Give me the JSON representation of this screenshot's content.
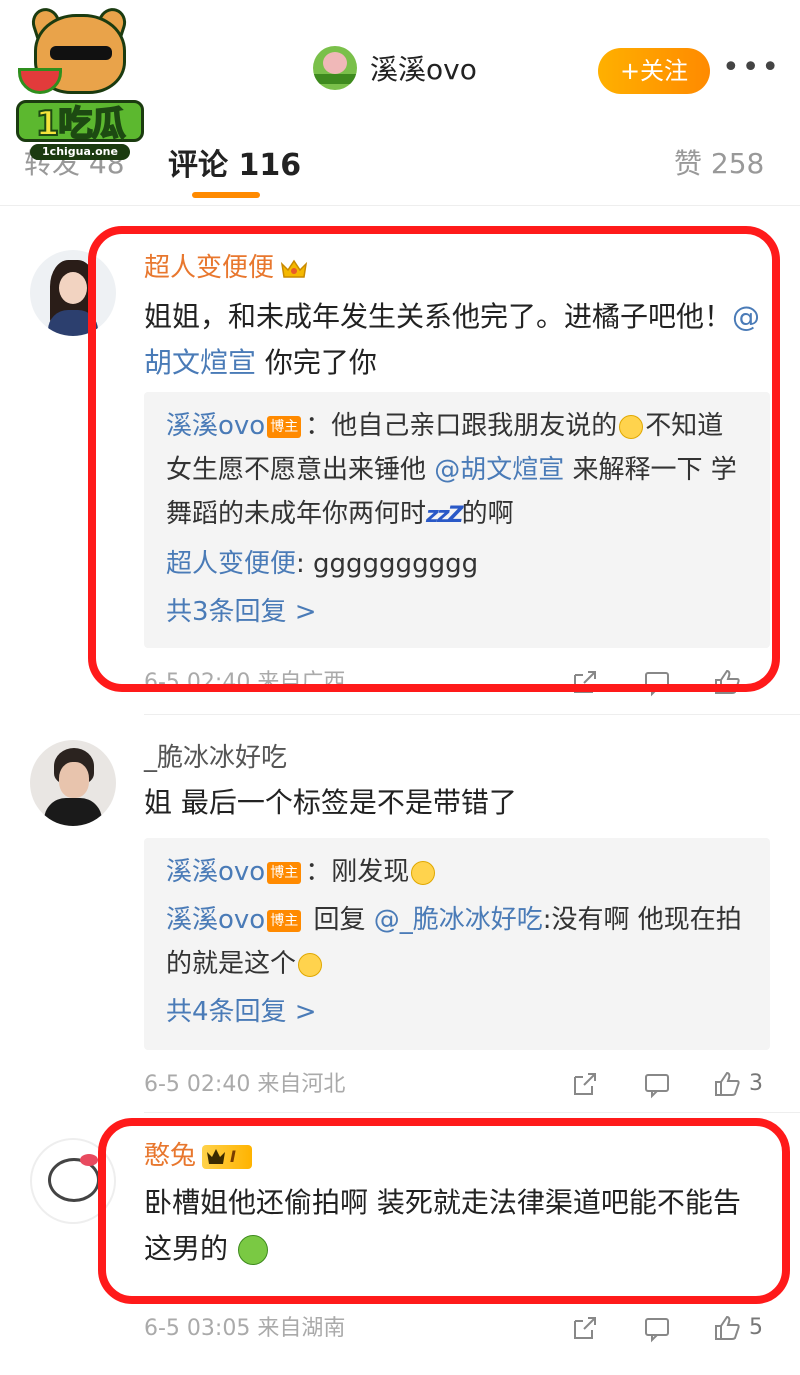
{
  "watermark": {
    "logo_text": "1吃瓜",
    "url": "1chigua.one"
  },
  "header": {
    "user_name": "溪溪ovo",
    "follow_label": "+关注",
    "more_label": "•••"
  },
  "tabs": {
    "repost": "转发 48",
    "comments": "评论 116",
    "likes": "赞 258"
  },
  "comments": [
    {
      "name": "超人变便便",
      "text_before": "姐姐，和未成年发生关系他完了。进橘子吧他！",
      "mention": "@胡文煊宣",
      "text_after": " 你完了你",
      "replies": {
        "r1_name": "溪溪ovo",
        "r1_tag": "博主",
        "r1_text_a": "：他自己亲口跟我朋友说的",
        "r1_text_b": "不知道女生愿不愿意出来锤他 ",
        "r1_mention": "@胡文煊宣",
        "r1_text_c": " 来解释一下 学舞蹈的未成年你两何时",
        "r1_zzz": "zzZ",
        "r1_text_d": "的啊",
        "r2_name": "超人变便便",
        "r2_text": ": gggggggggg",
        "more": "共3条回复 >"
      },
      "meta": "6-5 02:40 来自广西"
    },
    {
      "name": "_脆冰冰好吃",
      "text": "姐 最后一个标签是不是带错了",
      "replies": {
        "r1_name": "溪溪ovo",
        "r1_tag": "博主",
        "r1_text": "：刚发现",
        "r2_name": "溪溪ovo",
        "r2_tag": "博主",
        "r2_text_a": " 回复 ",
        "r2_mention": "@_脆冰冰好吃",
        "r2_text_b": ":没有啊 他现在拍的就是这个",
        "more": "共4条回复 >"
      },
      "meta": "6-5 02:40 来自河北",
      "like_count": "3"
    },
    {
      "name": "憨兔",
      "vip_level": "I",
      "text": "卧槽姐他还偷拍啊 装死就走法律渠道吧能不能告这男的",
      "meta": "6-5 03:05 来自湖南",
      "like_count": "5"
    }
  ],
  "colors": {
    "accent_orange": "#ff8a00",
    "link_blue": "#4a7bb7",
    "highlight_red": "#ff1a1a"
  }
}
